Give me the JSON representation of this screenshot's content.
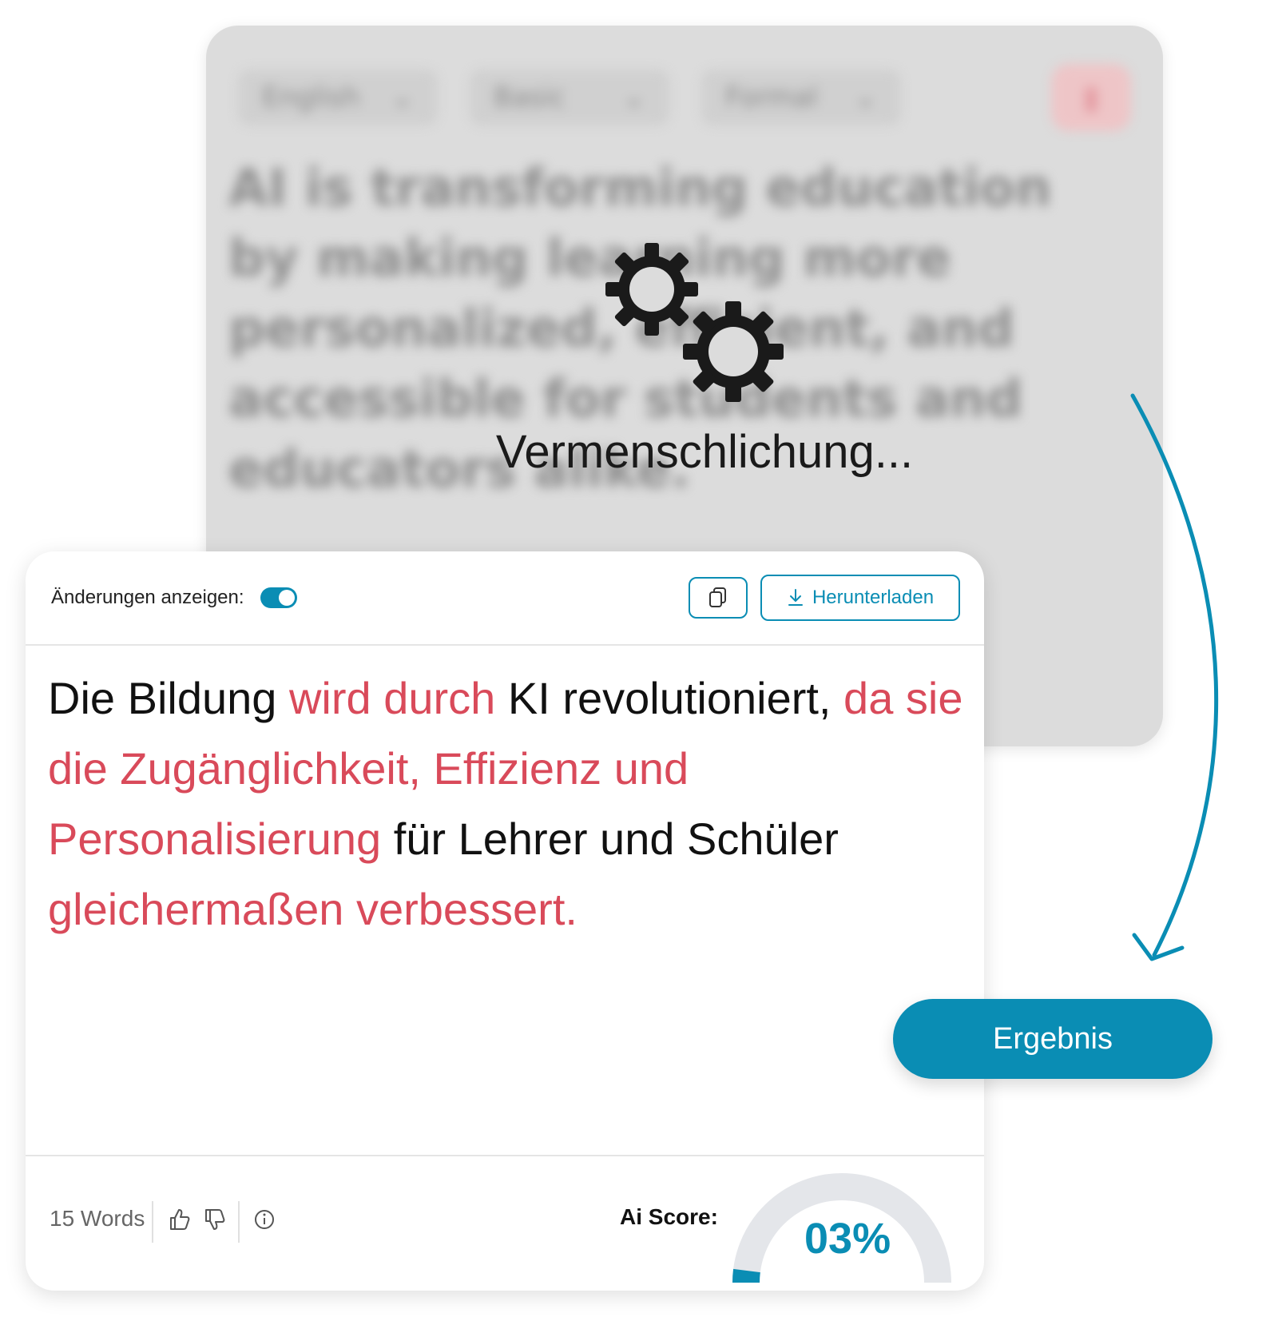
{
  "processing_card": {
    "selects": [
      "English",
      "Basic",
      "Formal"
    ],
    "blurred_text": "AI is transforming education by making learning more personalized, efficient, and accessible for students and educators alike.",
    "status": "Vermenschlichung..."
  },
  "result_card": {
    "changes_label": "Änderungen anzeigen:",
    "changes_toggle_on": true,
    "download_label": "Herunterladen",
    "text_segments": [
      {
        "text": "Die Bildung ",
        "changed": false
      },
      {
        "text": "wird durch",
        "changed": true
      },
      {
        "text": " KI revolutioniert, ",
        "changed": false
      },
      {
        "text": "da sie die Zugänglichkeit, Effizienz und Personalisierung",
        "changed": true
      },
      {
        "text": " für Lehrer und Schüler ",
        "changed": false
      },
      {
        "text": "gleichermaßen verbessert.",
        "changed": true
      }
    ],
    "word_count": "15 Words",
    "ai_score_label": "Ai Score:",
    "ai_score_value": "03%",
    "ai_score_fraction": 0.03
  },
  "result_button_label": "Ergebnis",
  "colors": {
    "accent": "#0a8db4",
    "changed_text": "#d94a5a",
    "overlay_gray": "#dcdcdc"
  },
  "icons": [
    "gears-icon",
    "copy-icon",
    "download-icon",
    "thumbs-up-icon",
    "thumbs-down-icon",
    "info-icon",
    "curved-arrow-icon"
  ]
}
